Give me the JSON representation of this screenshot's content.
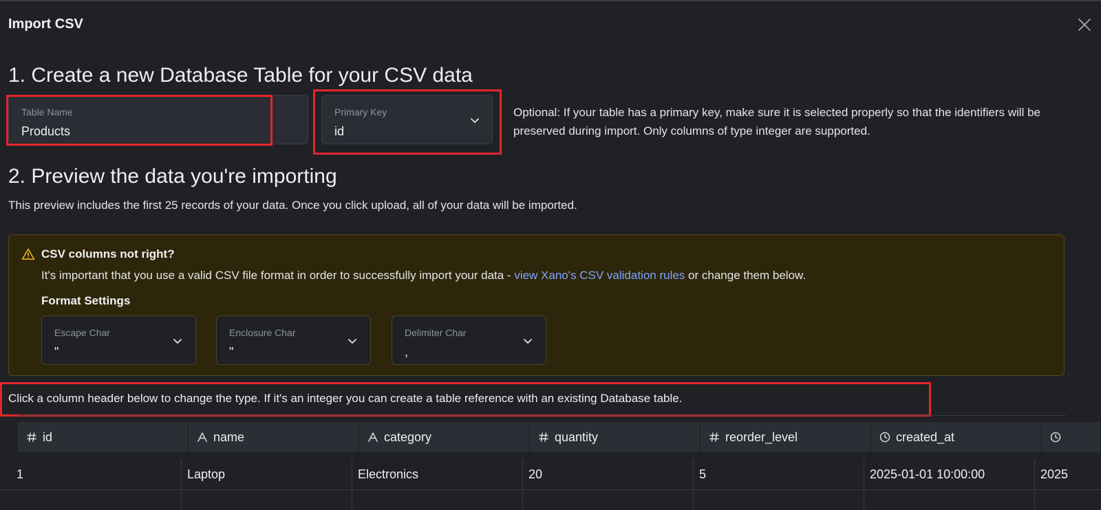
{
  "modal": {
    "title": "Import CSV"
  },
  "section1": {
    "heading": "1. Create a new Database Table for your CSV data",
    "table_name": {
      "label": "Table Name",
      "value": "Products"
    },
    "primary_key": {
      "label": "Primary Key",
      "value": "id"
    },
    "note": "Optional: If your table has a primary key, make sure it is selected properly so that the identifiers will be preserved during import. Only columns of type integer are supported."
  },
  "section2": {
    "heading": "2. Preview the data you're importing",
    "description": "This preview includes the first 25 records of your data. Once you click upload, all of your data will be imported."
  },
  "warning": {
    "title": "CSV columns not right?",
    "text_before": "It's important that you use a valid CSV file format in order to successfully import your data - ",
    "link": "view Xano's CSV validation rules",
    "text_after": " or change them below.",
    "format_title": "Format Settings",
    "fields": [
      {
        "label": "Escape Char",
        "value": "\""
      },
      {
        "label": "Enclosure Char",
        "value": "\""
      },
      {
        "label": "Delimiter Char",
        "value": ","
      }
    ]
  },
  "column_hint": "Click a column header below to change the type. If it's an integer you can create a table reference with an existing Database table.",
  "columns": [
    {
      "icon": "hash-icon",
      "name": "id"
    },
    {
      "icon": "text-type-icon",
      "name": "name"
    },
    {
      "icon": "text-type-icon",
      "name": "category"
    },
    {
      "icon": "hash-icon",
      "name": "quantity"
    },
    {
      "icon": "hash-icon",
      "name": "reorder_level"
    },
    {
      "icon": "clock-icon",
      "name": "created_at"
    },
    {
      "icon": "clock-icon",
      "name": ""
    }
  ],
  "rows": [
    [
      "1",
      "Laptop",
      "Electronics",
      "20",
      "5",
      "2025-01-01 10:00:00",
      "2025"
    ]
  ],
  "colors": {
    "highlight": "#e3262b",
    "link": "#7fa6ff",
    "warning_bg": "#2e260a"
  }
}
